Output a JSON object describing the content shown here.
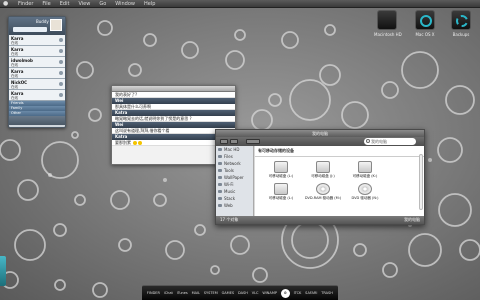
{
  "menubar": {
    "items": [
      "Finder",
      "File",
      "Edit",
      "View",
      "Go",
      "Window",
      "Help"
    ]
  },
  "desktop_icons": [
    {
      "label": "Macintosh HD"
    },
    {
      "label": "Mac OS X"
    },
    {
      "label": "Backups"
    }
  ],
  "buddy_list": {
    "username": "Buddy List",
    "contacts": [
      {
        "name": "Karra",
        "status": "在线"
      },
      {
        "name": "Karra",
        "status": "在线"
      },
      {
        "name": "idwolmob",
        "status": "在线"
      },
      {
        "name": "Karra",
        "status": "在线"
      },
      {
        "name": "NickOC",
        "status": "在线"
      },
      {
        "name": "Karra",
        "status": "在线"
      },
      {
        "name": "Seblom",
        "status": "在线"
      }
    ],
    "groups": [
      "Friends",
      "Family",
      "Other"
    ]
  },
  "chat": {
    "messages": [
      {
        "type": "msg",
        "text": "我的表好了?"
      },
      {
        "type": "hdr",
        "text": "Wei"
      },
      {
        "type": "msg",
        "text": "那具体是什么可养啊"
      },
      {
        "type": "hdr",
        "text": "Katra"
      },
      {
        "type": "msg",
        "text": "略晃略晃去的话,就说明你到了愣是的意思 ?"
      },
      {
        "type": "hdr",
        "text": "Wei"
      },
      {
        "type": "msg",
        "text": "这叫说有道理,拜拜,借你看个看"
      },
      {
        "type": "hdr",
        "text": "Katra"
      },
      {
        "type": "msg",
        "text": "要那别累"
      }
    ]
  },
  "finder": {
    "title": "我的电脑",
    "search_placeholder": "我的电脑",
    "sidebar": [
      "Mac HD",
      "Files",
      "Network",
      "Tools",
      "WallPaper",
      "Wi-Fi",
      "Music",
      "Stack",
      "Web"
    ],
    "category": "有可移动存储的设备",
    "items": [
      {
        "label": "可移动磁盘 (L:)",
        "kind": "drive"
      },
      {
        "label": "可移动磁盘 (J:)",
        "kind": "drive"
      },
      {
        "label": "可移动磁盘 (K:)",
        "kind": "drive"
      },
      {
        "label": "可移动磁盘 (L:)",
        "kind": "drive"
      },
      {
        "label": "DVD-RAM 驱动器 (M:)",
        "kind": "dvd"
      },
      {
        "label": "DVD 驱动器 (N:)",
        "kind": "dvd"
      }
    ],
    "status_left": "17 个对象",
    "status_right": "我的电脑"
  },
  "dock": {
    "items": [
      "FINDER",
      "iChat",
      "iTunes",
      "MAIL",
      "SYSTEM",
      "GAMES",
      "DASH",
      "VLC",
      "WINAMP",
      "",
      "ITCK",
      "SAFARI",
      "TRASH"
    ],
    "active_index": 9
  }
}
